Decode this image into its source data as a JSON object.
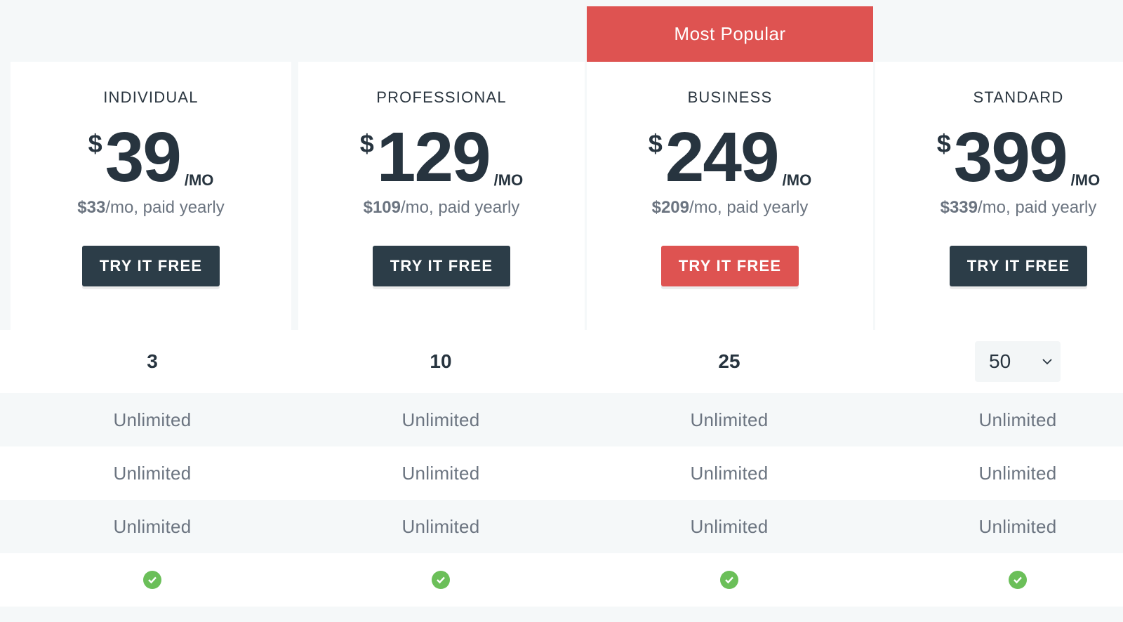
{
  "banner": {
    "most_popular": "Most Popular"
  },
  "plans": [
    {
      "name": "INDIVIDUAL",
      "currency": "$",
      "amount": "39",
      "per": "/MO",
      "yearly_price": "$33",
      "yearly_suffix": "/mo, paid yearly",
      "cta": "TRY IT FREE",
      "users": "3",
      "check": true
    },
    {
      "name": "PROFESSIONAL",
      "currency": "$",
      "amount": "129",
      "per": "/MO",
      "yearly_price": "$109",
      "yearly_suffix": "/mo, paid yearly",
      "cta": "TRY IT FREE",
      "users": "10",
      "check": true
    },
    {
      "name": "BUSINESS",
      "currency": "$",
      "amount": "249",
      "per": "/MO",
      "yearly_price": "$209",
      "yearly_suffix": "/mo, paid yearly",
      "cta": "TRY IT FREE",
      "users": "25",
      "check": true
    },
    {
      "name": "STANDARD",
      "currency": "$",
      "amount": "399",
      "per": "/MO",
      "yearly_price": "$339",
      "yearly_suffix": "/mo, paid yearly",
      "cta": "TRY IT FREE",
      "users": "50",
      "check": true
    }
  ],
  "feature_rows": [
    [
      "Unlimited",
      "Unlimited",
      "Unlimited",
      "Unlimited"
    ],
    [
      "Unlimited",
      "Unlimited",
      "Unlimited",
      "Unlimited"
    ],
    [
      "Unlimited",
      "Unlimited",
      "Unlimited",
      "Unlimited"
    ]
  ],
  "colors": {
    "accent": "#de5351",
    "button_dark": "#2c3d48",
    "check_green": "#6bbf59",
    "text_dark": "#27343f",
    "text_muted": "#6b7480"
  },
  "icons": {
    "select": "chevron-down-icon",
    "included": "check-circle-icon"
  }
}
